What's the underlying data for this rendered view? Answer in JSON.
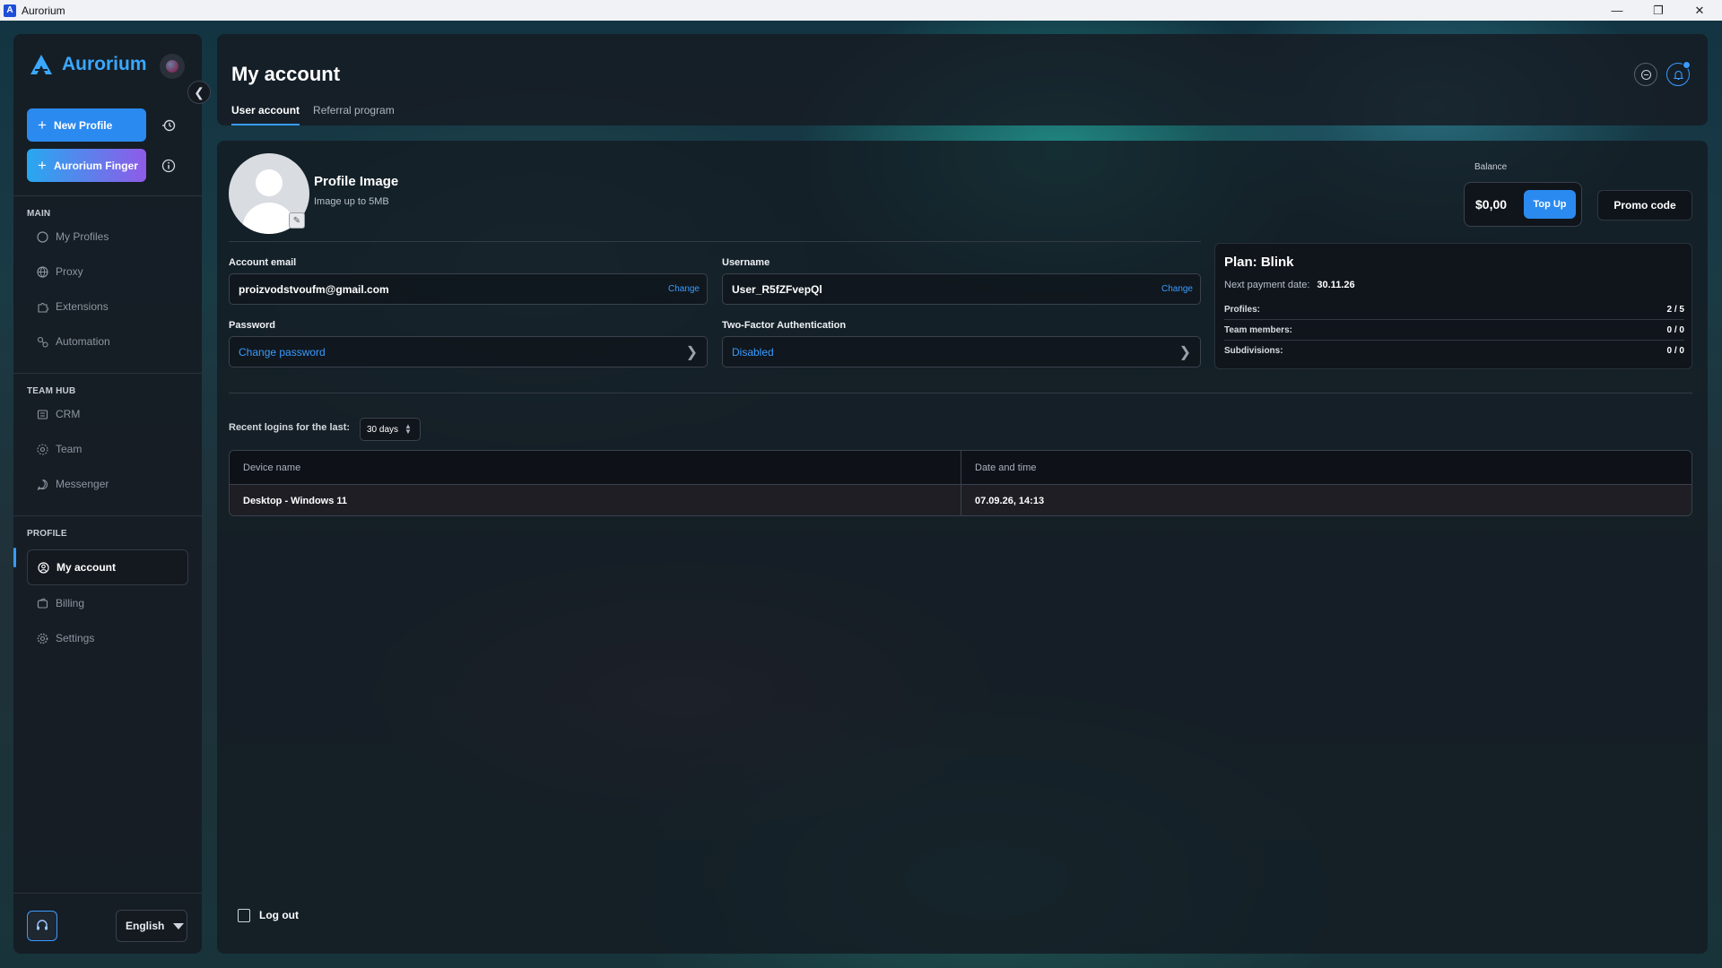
{
  "window": {
    "title": "Aurorium",
    "controls": [
      "minimize-icon",
      "restore-icon",
      "close-icon"
    ]
  },
  "sidebar": {
    "brand": "Aurorium",
    "new_profile_label": "New Profile",
    "finger_label": "Aurorium Finger",
    "sections": {
      "main": "MAIN",
      "team_hub": "TEAM HUB",
      "profile": "PROFILE"
    },
    "main_items": [
      {
        "label": "My Profiles",
        "icon": "circle-icon"
      },
      {
        "label": "Proxy",
        "icon": "globe-icon"
      },
      {
        "label": "Extensions",
        "icon": "puzzle-icon"
      },
      {
        "label": "Automation",
        "icon": "automation-icon"
      }
    ],
    "team_items": [
      {
        "label": "CRM",
        "icon": "crm-icon"
      },
      {
        "label": "Team",
        "icon": "team-icon"
      },
      {
        "label": "Messenger",
        "icon": "chat-icon"
      }
    ],
    "profile_items": [
      {
        "label": "My account",
        "icon": "user-circle-icon",
        "active": true
      },
      {
        "label": "Billing",
        "icon": "billing-icon"
      },
      {
        "label": "Settings",
        "icon": "gear-icon"
      }
    ],
    "language": "English"
  },
  "header": {
    "title": "My account",
    "tabs": [
      {
        "label": "User account",
        "active": true
      },
      {
        "label": "Referral program",
        "active": false
      }
    ]
  },
  "profile_image": {
    "title": "Profile Image",
    "subtitle": "Image up to 5MB"
  },
  "account": {
    "email_label": "Account email",
    "email_value": "proizvodstvoufm@gmail.com",
    "username_label": "Username",
    "username_value": "User_R5fZFvepQl",
    "change_label": "Change",
    "password_label": "Password",
    "password_action": "Change password",
    "twofa_label": "Two-Factor Authentication",
    "twofa_value": "Disabled"
  },
  "balance": {
    "label": "Balance",
    "value": "$0,00",
    "topup_label": "Top Up",
    "promo_label": "Promo code"
  },
  "plan": {
    "title": "Plan: Blink",
    "next_payment_label": "Next payment date:",
    "next_payment_value": "30.11.26",
    "rows": [
      {
        "key": "Profiles:",
        "value": "2 / 5"
      },
      {
        "key": "Team members:",
        "value": "0 / 0"
      },
      {
        "key": "Subdivisions:",
        "value": "0 / 0"
      }
    ]
  },
  "logins": {
    "label": "Recent logins for the last:",
    "period": "30 days",
    "columns": [
      "Device name",
      "Date and time"
    ],
    "rows": [
      {
        "device": "Desktop - Windows 11",
        "datetime": "07.09.26, 14:13"
      }
    ]
  },
  "logout_label": "Log out",
  "colors": {
    "accent": "#3a9bff",
    "brand": "#3aa8ff",
    "finger_gradient_start": "#27a8f0",
    "finger_gradient_end": "#8f5be8"
  }
}
